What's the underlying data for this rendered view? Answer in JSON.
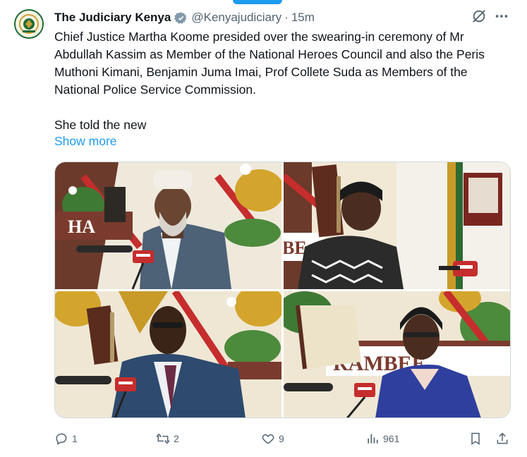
{
  "author": {
    "name": "The Judiciary Kenya",
    "handle": "@Kenyajudiciary",
    "separator": "·",
    "time": "15m"
  },
  "colors": {
    "accent": "#1d9bf0",
    "text": "#0f1419",
    "secondary": "#536471",
    "verified_badge": "#829aab"
  },
  "icons": {
    "verified": "verified-badge-icon",
    "grok": "grok-icon",
    "more": "more-icon",
    "reply": "reply-icon",
    "retweet": "retweet-icon",
    "like": "heart-icon",
    "views": "views-icon",
    "bookmark": "bookmark-icon",
    "share": "share-icon"
  },
  "tweet": {
    "paragraph1": "Chief Justice Martha Koome presided over the swearing-in ceremony of Mr Abdullah Kassim as Member of the National Heroes Council and also the Peris Muthoni Kimani, Benjamin Juma Imai, Prof Collete Suda as Members of the National Police Service Commission.",
    "paragraph2": "She told the new",
    "show_more": "Show more"
  },
  "media": {
    "photo1_sign": "HA",
    "photo2_sign": "BE",
    "photo4_sign": "RAMBEE"
  },
  "stats": {
    "replies": "1",
    "retweets": "2",
    "likes": "9",
    "views": "961"
  }
}
